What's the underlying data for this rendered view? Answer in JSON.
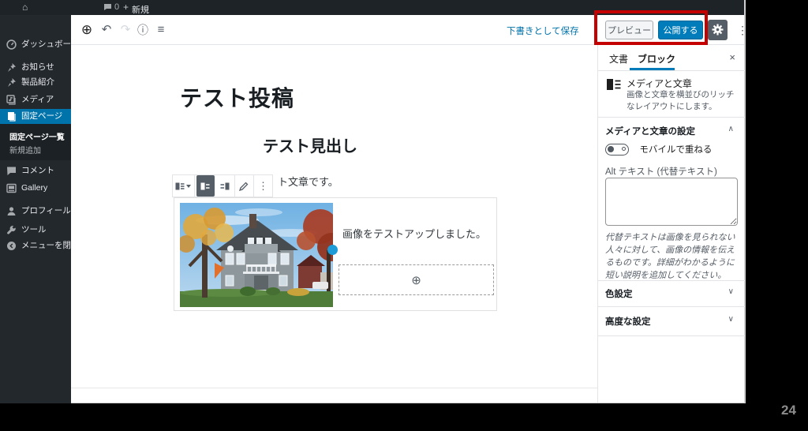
{
  "frame": {
    "page_number": "24"
  },
  "admin_bar": {
    "comment_count": "0",
    "plus": "+",
    "new_label": "新規",
    "home_icon": "⌂"
  },
  "sidebar": {
    "items": [
      {
        "label": "ダッシュボード",
        "icon": "dashboard-icon"
      },
      {
        "label": "お知らせ",
        "icon": "pin-icon"
      },
      {
        "label": "製品紹介",
        "icon": "pin-icon"
      },
      {
        "label": "メディア",
        "icon": "media-icon"
      },
      {
        "label": "固定ページ",
        "icon": "pages-icon",
        "active": true
      },
      {
        "label": "コメント",
        "icon": "comments-icon"
      },
      {
        "label": "Gallery",
        "icon": "gallery-icon"
      },
      {
        "label": "プロフィール",
        "icon": "profile-icon"
      },
      {
        "label": "ツール",
        "icon": "tools-icon"
      },
      {
        "label": "メニューを閉じる",
        "icon": "collapse-icon"
      }
    ],
    "submenu": {
      "current": "固定ページ一覧",
      "add_new": "新規追加"
    }
  },
  "editor_header": {
    "add_block": "⊕",
    "undo": "↶",
    "redo": "↷",
    "info": "ⓘ",
    "structure": "≡",
    "save_draft_label": "下書きとして保存",
    "preview_label": "プレビュー",
    "publish_label": "公開する",
    "more_label": "⋮"
  },
  "content": {
    "post_title": "テスト投稿",
    "heading": "テスト見出し",
    "paragraph_visible": "ト文章です。",
    "media_text": "画像をテストアップしました。",
    "appender_plus": "⊕",
    "block_toolbar_more": "⋮"
  },
  "panel": {
    "tabs": {
      "document": "文書",
      "block": "ブロック"
    },
    "active_tab": "ブロック",
    "close": "×",
    "block_name": "メディアと文章",
    "block_desc": "画像と文章を横並びのリッチなレイアウトにします。",
    "settings_title": "メディアと文章の設定",
    "settings_chevron": "∧",
    "toggle_label": "モバイルで重ねる",
    "alt_label": "Alt テキスト (代替テキスト)",
    "alt_value": "",
    "alt_help": "代替テキストは画像を見られない人々に対して、画像の情報を伝えるものです。詳細がわかるように短い説明を追加してください。",
    "color_settings": "色設定",
    "advanced_settings": "高度な設定",
    "collapsed_chevron": "∨"
  },
  "colors": {
    "wp_admin_dark": "#23282d",
    "active_blue": "#0073aa",
    "publish_blue": "#007cba",
    "annotation_red": "#c40000",
    "drag_handle_blue": "#1e9cd7"
  }
}
